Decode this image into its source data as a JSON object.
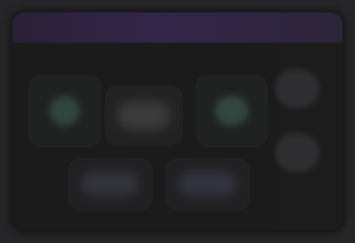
{
  "window": {
    "title_text": "",
    "accent_color": "#33264a"
  },
  "tiles": [
    {
      "name": "tile-1",
      "icon": "app-icon"
    },
    {
      "name": "tile-2",
      "icon": "app-icon"
    },
    {
      "name": "tile-3",
      "icon": "app-icon"
    },
    {
      "name": "tile-4",
      "icon": "app-icon"
    },
    {
      "name": "tile-5",
      "icon": "app-icon"
    }
  ],
  "side_panel": {
    "buttons": [
      {
        "icon": "control-icon"
      },
      {
        "icon": "control-icon"
      }
    ]
  }
}
